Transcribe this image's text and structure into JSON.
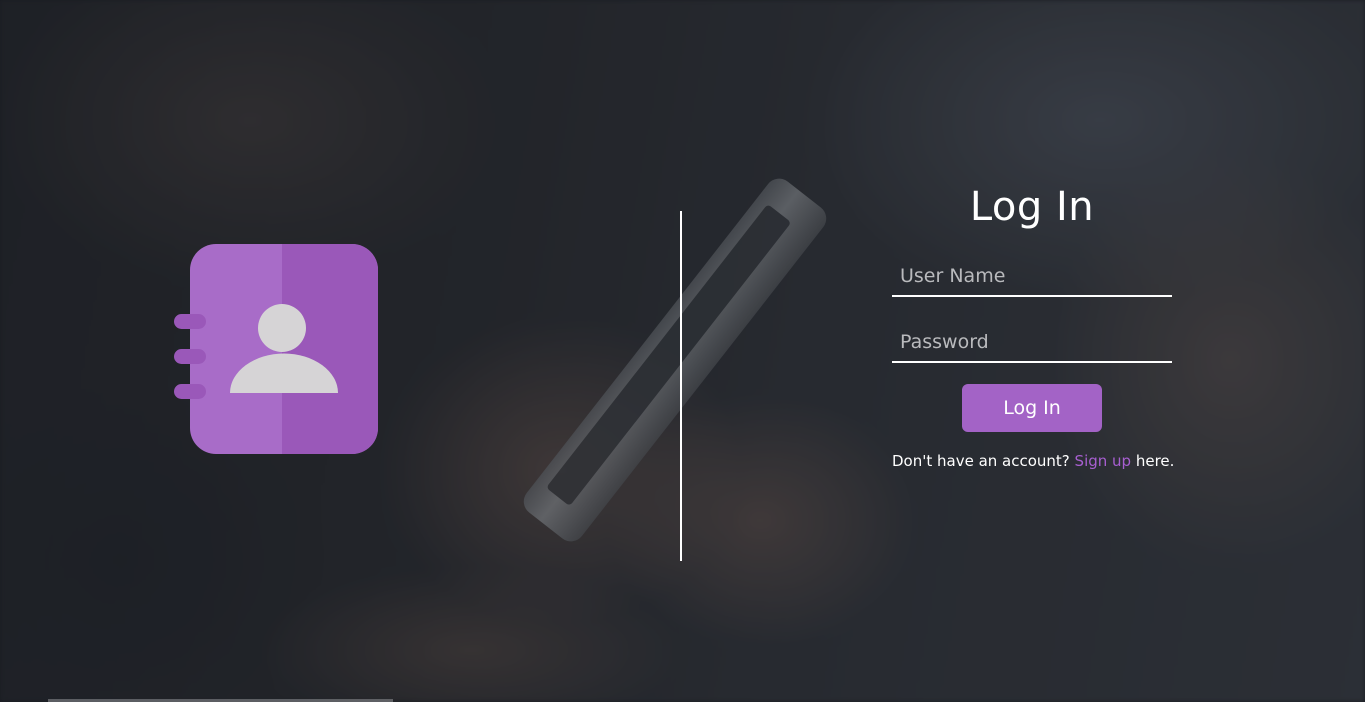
{
  "login": {
    "title": "Log In",
    "username_placeholder": "User Name",
    "password_placeholder": "Password",
    "submit_label": "Log In",
    "signup_prefix": "Don't have an account? ",
    "signup_link": "Sign up",
    "signup_suffix": " here."
  },
  "icons": {
    "left_logo": "contact-book-icon"
  },
  "colors": {
    "accent": "#a363c6",
    "link": "#a75fd0",
    "icon_light": "#a86cc8",
    "icon_dark": "#9a58b9",
    "icon_person": "#d6d4d6"
  }
}
